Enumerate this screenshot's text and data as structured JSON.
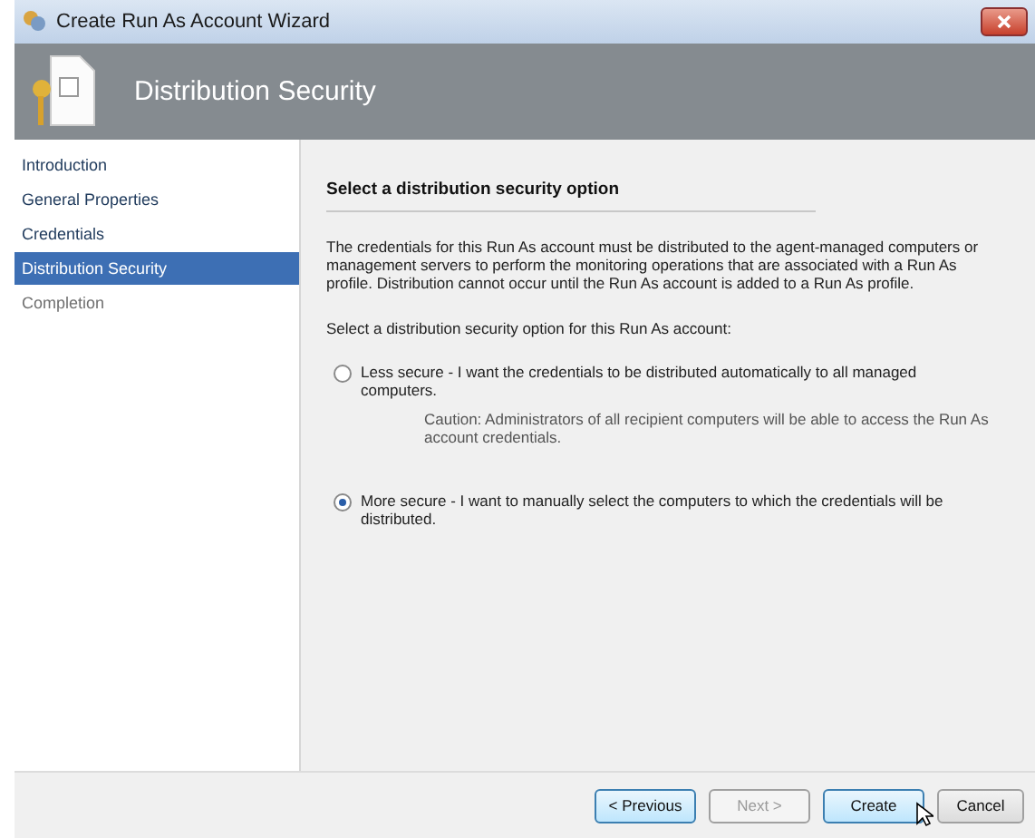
{
  "window": {
    "title": "Create Run As Account Wizard"
  },
  "header": {
    "title": "Distribution Security"
  },
  "sidebar": {
    "items": [
      {
        "label": "Introduction",
        "selected": false,
        "disabled": false
      },
      {
        "label": "General Properties",
        "selected": false,
        "disabled": false
      },
      {
        "label": "Credentials",
        "selected": false,
        "disabled": false
      },
      {
        "label": "Distribution Security",
        "selected": true,
        "disabled": false
      },
      {
        "label": "Completion",
        "selected": false,
        "disabled": true
      }
    ]
  },
  "content": {
    "heading": "Select a distribution security option",
    "description": "The credentials for this Run As account must be distributed to the agent-managed computers or management servers to perform the monitoring operations that are associated with a Run As profile. Distribution cannot occur until the Run As account is added to a Run As profile.",
    "prompt": "Select a distribution security option for this Run As account:",
    "options": [
      {
        "label": "Less secure - I want the credentials to be distributed automatically to all managed computers.",
        "selected": false,
        "note": "Caution: Administrators of all recipient computers will be able to access the Run As account credentials."
      },
      {
        "label": "More secure - I want to manually select the computers to which the credentials will be distributed.",
        "selected": true
      }
    ]
  },
  "buttons": [
    {
      "label": "< Previous",
      "disabled": false,
      "focused": true
    },
    {
      "label": "Next >",
      "disabled": true,
      "focused": false
    },
    {
      "label": "Create",
      "disabled": false,
      "focused": true
    },
    {
      "label": "Cancel",
      "disabled": false,
      "focused": false
    }
  ]
}
